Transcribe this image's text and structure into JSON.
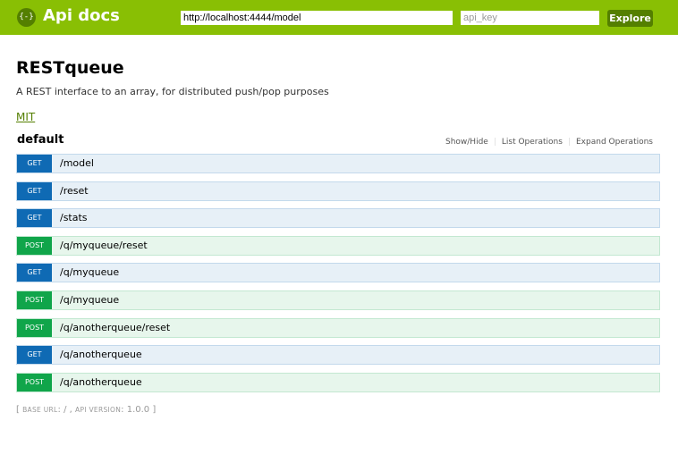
{
  "header": {
    "logo_glyph": "{-}",
    "title": "Api docs",
    "url_value": "http://localhost:4444/model",
    "api_key_placeholder": "api_key",
    "api_key_value": "",
    "explore_label": "Explore",
    "background_color": "#89bf04"
  },
  "info": {
    "title": "RESTqueue",
    "description": "A REST interface to an array, for distributed push/pop purposes",
    "license": "MIT"
  },
  "resource": {
    "name": "default",
    "show_hide": "Show/Hide",
    "list_operations": "List Operations",
    "expand_operations": "Expand Operations"
  },
  "endpoints": [
    {
      "method": "GET",
      "path": "/model"
    },
    {
      "method": "GET",
      "path": "/reset"
    },
    {
      "method": "GET",
      "path": "/stats"
    },
    {
      "method": "POST",
      "path": "/q/myqueue/reset"
    },
    {
      "method": "GET",
      "path": "/q/myqueue"
    },
    {
      "method": "POST",
      "path": "/q/myqueue"
    },
    {
      "method": "POST",
      "path": "/q/anotherqueue/reset"
    },
    {
      "method": "GET",
      "path": "/q/anotherqueue"
    },
    {
      "method": "POST",
      "path": "/q/anotherqueue"
    }
  ],
  "footer": {
    "open": "[",
    "base_url_label": "BASE URL",
    "base_url_value": "/",
    "api_version_label": "API VERSION",
    "api_version_value": "1.0.0",
    "close": "]"
  },
  "colors": {
    "get": "#0f6ab4",
    "post": "#10a54a",
    "link": "#547f00"
  }
}
